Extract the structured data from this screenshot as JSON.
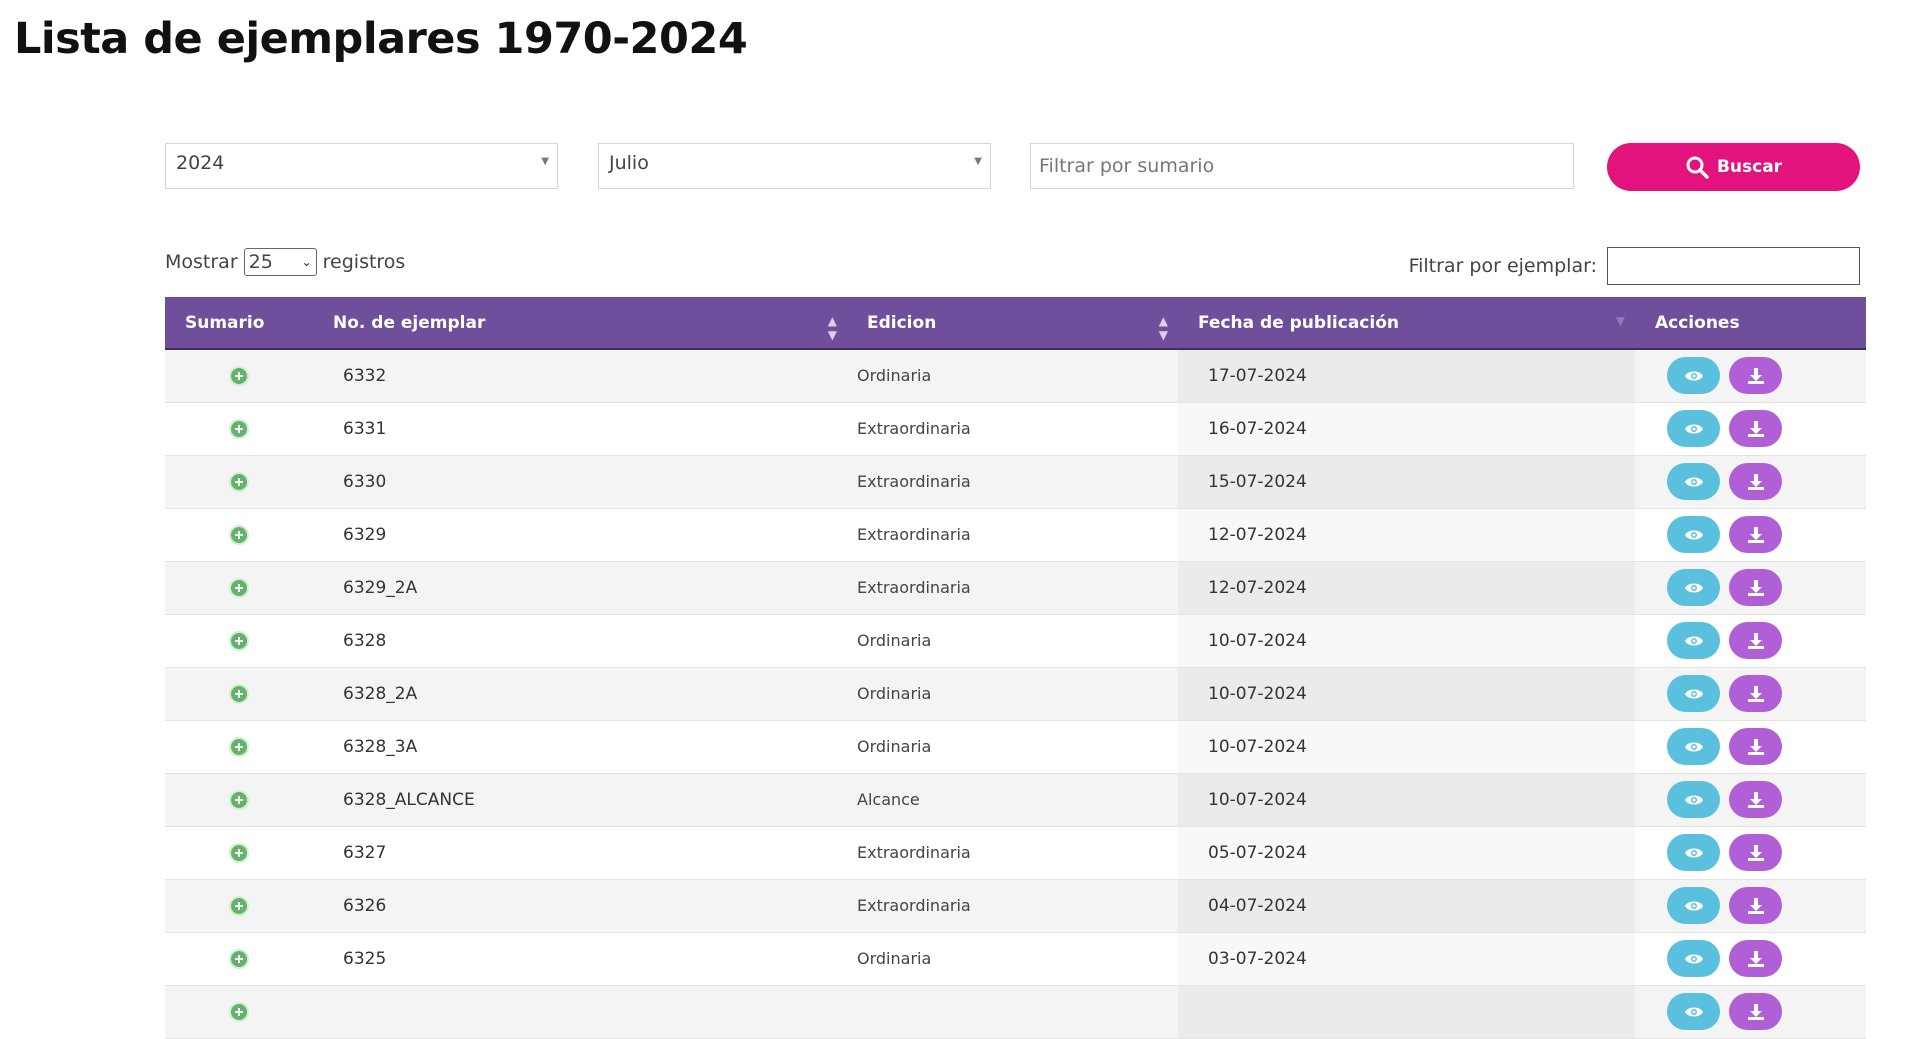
{
  "page": {
    "title": "Lista de ejemplares 1970-2024"
  },
  "filters": {
    "year_value": "2024",
    "month_value": "Julio",
    "summary_placeholder": "Filtrar por sumario",
    "search_label": "Buscar"
  },
  "table_controls": {
    "show_label": "Mostrar",
    "show_value": "25",
    "records_label": "registros",
    "issue_filter_label": "Filtrar por ejemplar:"
  },
  "table": {
    "headers": {
      "summary": "Sumario",
      "issue": "No. de ejemplar",
      "edition": "Edicion",
      "date": "Fecha de publicación",
      "actions": "Acciones"
    },
    "rows": [
      {
        "issue": "6332",
        "edition": "Ordinaria",
        "date": "17-07-2024"
      },
      {
        "issue": "6331",
        "edition": "Extraordinaria",
        "date": "16-07-2024"
      },
      {
        "issue": "6330",
        "edition": "Extraordinaria",
        "date": "15-07-2024"
      },
      {
        "issue": "6329",
        "edition": "Extraordinaria",
        "date": "12-07-2024"
      },
      {
        "issue": "6329_2A",
        "edition": "Extraordinaria",
        "date": "12-07-2024"
      },
      {
        "issue": "6328",
        "edition": "Ordinaria",
        "date": "10-07-2024"
      },
      {
        "issue": "6328_2A",
        "edition": "Ordinaria",
        "date": "10-07-2024"
      },
      {
        "issue": "6328_3A",
        "edition": "Ordinaria",
        "date": "10-07-2024"
      },
      {
        "issue": "6328_ALCANCE",
        "edition": "Alcance",
        "date": "10-07-2024"
      },
      {
        "issue": "6327",
        "edition": "Extraordinaria",
        "date": "05-07-2024"
      },
      {
        "issue": "6326",
        "edition": "Extraordinaria",
        "date": "04-07-2024"
      },
      {
        "issue": "6325",
        "edition": "Ordinaria",
        "date": "03-07-2024"
      },
      {
        "issue": "",
        "edition": "",
        "date": ""
      }
    ]
  },
  "icons": {
    "expand": "plus-circle-icon",
    "view": "eye-icon",
    "download": "download-icon",
    "search": "search-icon"
  },
  "colors": {
    "header_bg": "#6f4f9b",
    "search_button": "#e2137c",
    "view_button": "#5bc0de",
    "download_button": "#b15fd6",
    "expand_icon": "#63b36a"
  }
}
